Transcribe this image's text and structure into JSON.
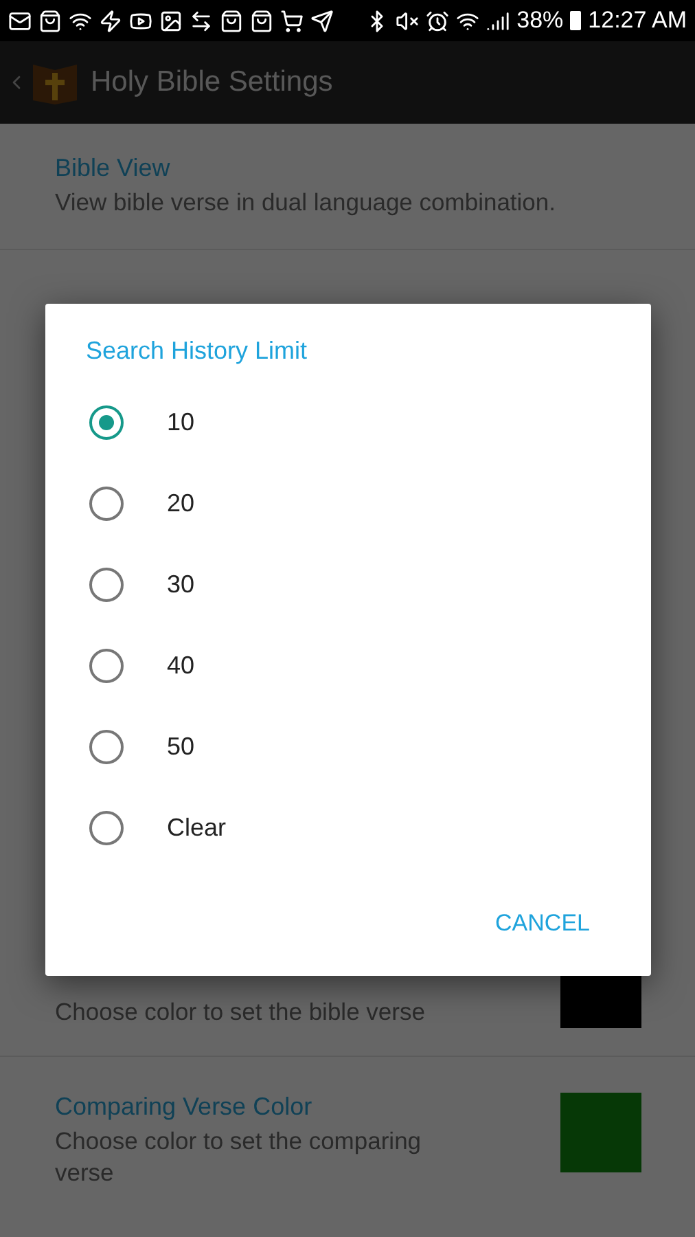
{
  "status_bar": {
    "battery": "38%",
    "time": "12:27 AM"
  },
  "toolbar": {
    "title": "Holy Bible Settings"
  },
  "settings": [
    {
      "kind": "text",
      "title": "Bible View",
      "description": "View bible verse in dual language combination."
    },
    {
      "kind": "color",
      "description": "Choose color to set the bible verse",
      "color": "#000000"
    },
    {
      "kind": "color",
      "title": "Comparing Verse Color",
      "description": "Choose color to set the comparing verse",
      "color": "#063806"
    }
  ],
  "dialog": {
    "title": "Search History Limit",
    "options": [
      {
        "label": "10",
        "selected": true
      },
      {
        "label": "20",
        "selected": false
      },
      {
        "label": "30",
        "selected": false
      },
      {
        "label": "40",
        "selected": false
      },
      {
        "label": "50",
        "selected": false
      },
      {
        "label": "Clear",
        "selected": false
      }
    ],
    "buttons": [
      "CANCEL"
    ]
  }
}
